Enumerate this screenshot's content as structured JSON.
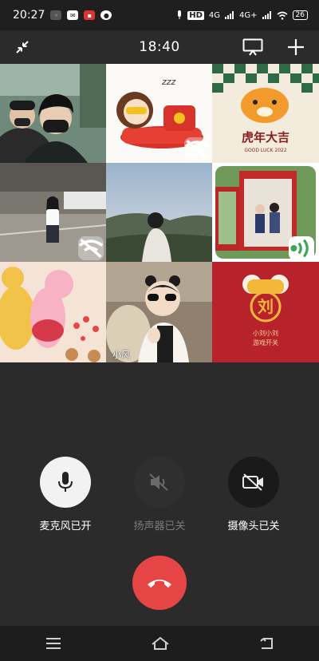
{
  "status_bar": {
    "time": "20:27",
    "indicators": [
      "notification-icon",
      "mail-icon",
      "app-icon",
      "app-icon"
    ],
    "network_1": "HD",
    "network_2": "4G",
    "network_3": "4G+",
    "battery": "26"
  },
  "call": {
    "elapsed": "18:40"
  },
  "participants": [
    {
      "id": "p1",
      "name": ""
    },
    {
      "id": "p2",
      "name": ""
    },
    {
      "id": "p3",
      "name": ""
    },
    {
      "id": "p4",
      "name": ""
    },
    {
      "id": "p5",
      "name": ""
    },
    {
      "id": "p6",
      "name": ""
    },
    {
      "id": "p7",
      "name": ""
    },
    {
      "id": "p8",
      "name": "小风"
    },
    {
      "id": "p9",
      "name": ""
    }
  ],
  "tile_text": {
    "tiger_title": "虎年大吉",
    "tiger_sub": "GOOD LUCK 2022",
    "zzz": "zzz",
    "red_char": "刘",
    "red_line1": "小刘小刘",
    "red_line2": "游戏开关"
  },
  "controls": {
    "mic_label": "麦克风已开",
    "speaker_label": "扬声器已关",
    "camera_label": "摄像头已关"
  },
  "colors": {
    "hangup": "#e54545",
    "speaking_badge": "#3aa857",
    "accent_red": "#c0262b"
  }
}
